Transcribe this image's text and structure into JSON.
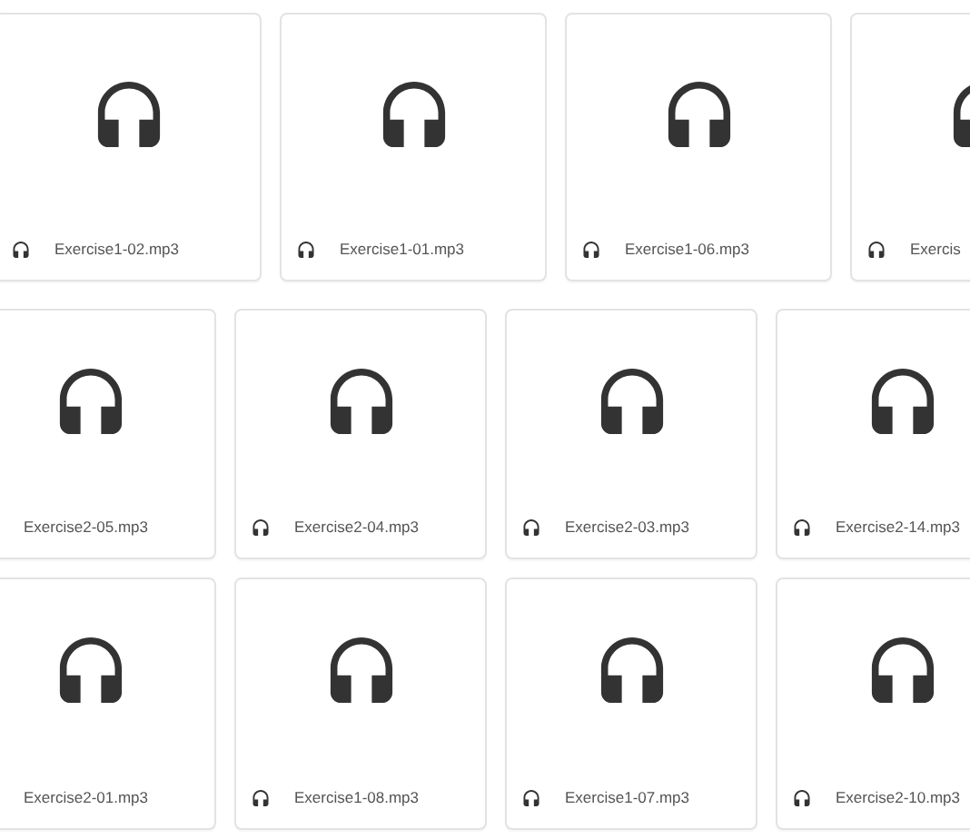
{
  "rows": [
    {
      "cards": [
        {
          "name": "Exercise1-02.mp3"
        },
        {
          "name": "Exercise1-01.mp3"
        },
        {
          "name": "Exercise1-06.mp3"
        },
        {
          "name": "Exercis"
        }
      ]
    },
    {
      "cards": [
        {
          "name": "Exercise2-05.mp3",
          "icon_hidden": true
        },
        {
          "name": "Exercise2-04.mp3"
        },
        {
          "name": "Exercise2-03.mp3"
        },
        {
          "name": "Exercise2-14.mp3"
        }
      ]
    },
    {
      "cards": [
        {
          "name": "Exercise2-01.mp3",
          "icon_hidden": true
        },
        {
          "name": "Exercise1-08.mp3"
        },
        {
          "name": "Exercise1-07.mp3"
        },
        {
          "name": "Exercise2-10.mp3"
        }
      ]
    }
  ]
}
